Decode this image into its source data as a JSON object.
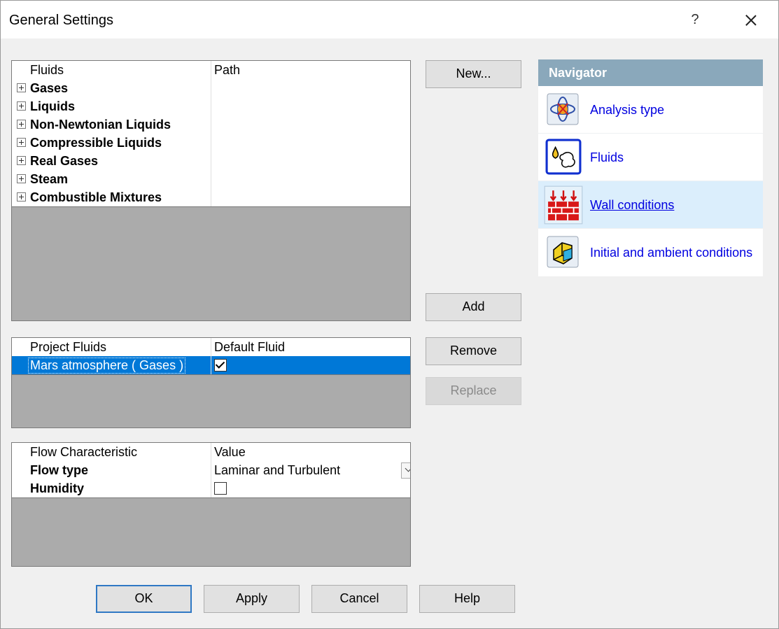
{
  "window": {
    "title": "General Settings",
    "help_glyph": "?"
  },
  "fluids_table": {
    "headers": [
      "Fluids",
      "Path"
    ],
    "groups": [
      "Gases",
      "Liquids",
      "Non-Newtonian Liquids",
      "Compressible Liquids",
      "Real Gases",
      "Steam",
      "Combustible Mixtures"
    ]
  },
  "project_fluids_table": {
    "headers": [
      "Project Fluids",
      "Default Fluid"
    ],
    "rows": [
      {
        "name": "Mars atmosphere ( Gases )",
        "default": true
      }
    ]
  },
  "flow_table": {
    "headers": [
      "Flow Characteristic",
      "Value"
    ],
    "rows": [
      {
        "name": "Flow type",
        "value": "Laminar and Turbulent"
      },
      {
        "name": "Humidity",
        "checked": false
      }
    ]
  },
  "buttons": {
    "new": "New...",
    "add": "Add",
    "remove": "Remove",
    "replace": "Replace"
  },
  "footer": {
    "ok": "OK",
    "apply": "Apply",
    "cancel": "Cancel",
    "help": "Help"
  },
  "navigator": {
    "title": "Navigator",
    "items": [
      {
        "label": "Analysis type",
        "icon": "analysis-type-icon"
      },
      {
        "label": "Fluids",
        "icon": "fluids-icon"
      },
      {
        "label": " Wall conditions",
        "icon": "wall-conditions-icon"
      },
      {
        "label": "Initial and ambient conditions",
        "icon": "initial-conditions-icon"
      }
    ]
  },
  "colors": {
    "selection": "#0078d7",
    "navigator_header": "#8aa8bb",
    "link": "#0000e0",
    "grid_empty": "#ababab"
  }
}
